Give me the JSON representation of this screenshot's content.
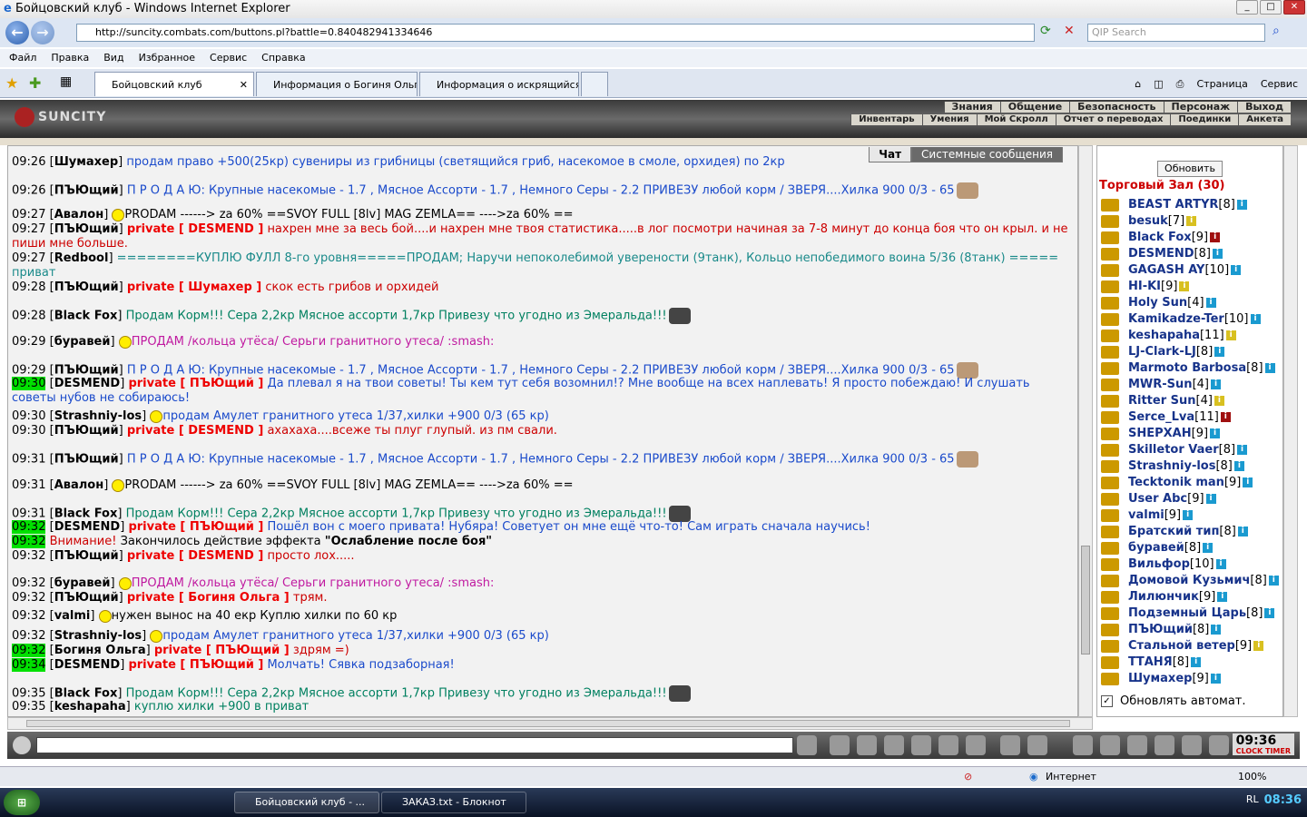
{
  "window": {
    "title": "Бойцовский клуб - Windows Internet Explorer",
    "controls": [
      "minimize-icon",
      "maximize-icon",
      "close-icon"
    ]
  },
  "browser": {
    "url": "http://suncity.combats.com/buttons.pl?battle=0.840482941334646",
    "search_placeholder": "QIP Search",
    "menu": [
      "Файл",
      "Правка",
      "Вид",
      "Избранное",
      "Сервис",
      "Справка"
    ],
    "tabs": [
      "Бойцовский клуб",
      "Информация о Богиня Ольга",
      "Информация о искрящийся"
    ],
    "tools": [
      "Страница",
      "Сервис"
    ],
    "status_zone": "Интернет",
    "zoom": "100%"
  },
  "game": {
    "logo": "SUNCITY",
    "nav_top": [
      "Знания",
      "Общение",
      "Безопасность",
      "Персонаж",
      "Выход"
    ],
    "nav_bottom": [
      "Инвентарь",
      "Умения",
      "Мой Скролл",
      "Отчет о переводах",
      "Поединки",
      "Анкета"
    ],
    "chat_tabs": [
      "Чат",
      "Системные сообщения"
    ],
    "chat": [
      {
        "time": "09:26",
        "nick": "Шумахер",
        "text": "продам право +500(25кр) сувениры из грибницы (светящийся гриб, насекомое в смоле, орхидея) по 2кр",
        "color": "blue"
      },
      {
        "time": "09:26",
        "nick": "ПЪЮщий",
        "text": "П Р О Д А Ю: Крупные насекомые - 1.7 , Мясное Ассорти - 1.7 , Немного Серы - 2.2 ПРИВЕЗУ любой корм / ЗВЕРЯ....Хилка 900 0/3 - 65",
        "color": "blue"
      },
      {
        "time": "09:27",
        "nick": "Авалон",
        "text": "PRODAM ------> za 60% ==SVOY FULL [8lv] MAG ZEMLA== ---->za 60% ==",
        "color": "olive"
      },
      {
        "time": "09:27",
        "nick": "ПЪЮщий",
        "private": "private [ DESMEND ]",
        "text": "нахрен мне за весь бой....и нахрен мне твоя статистика.....в лог посмотри начиная за 7-8 минут до конца боя что он крыл. и не пиши мне больше.",
        "color": "red"
      },
      {
        "time": "09:27",
        "nick": "Redbool",
        "text": "========КУПЛЮ ФУЛЛ 8-го уровня=====ПРОДАМ; Наручи непоколебимой уверености (9танк), Кольцо непобедимого воина 5/36 (8танк) ===== приват",
        "color": "teal"
      },
      {
        "time": "09:28",
        "nick": "ПЪЮщий",
        "private": "private [ Шумахер ]",
        "text": "скок есть грибов и орхидей",
        "color": "red"
      },
      {
        "time": "09:28",
        "nick": "Black Fox",
        "text": "Продам Корм!!! Сера 2,2кр Мясное ассорти 1,7кр Привезу что угодно из Эмеральда!!!",
        "color": "green"
      },
      {
        "time": "09:29",
        "nick": "буравей",
        "text": "ПРОДАМ /кольца утёса/ Серьги гранитного утеса/ :smash:",
        "color": "magenta"
      },
      {
        "time": "09:29",
        "nick": "ПЪЮщий",
        "text": "П Р О Д А Ю: Крупные насекомые - 1.7 , Мясное Ассорти - 1.7 , Немного Серы - 2.2 ПРИВЕЗУ любой корм / ЗВЕРЯ....Хилка 900 0/3 - 65",
        "color": "blue"
      },
      {
        "time": "09:30",
        "nick": "DESMEND",
        "private": "private [ ПЪЮщий ]",
        "text": "Да плевал я на твои советы! Ты кем тут себя возомнил!? Мне вообще на всех наплевать! Я просто побеждаю! И слушать советы нубов не собираюсь!",
        "color": "blue",
        "hl": true
      },
      {
        "time": "09:30",
        "nick": "Strashniy-los",
        "text": "продам Амулет гранитного утеса 1/37,хилки +900 0/3 (65 кр)",
        "color": "blue"
      },
      {
        "time": "09:30",
        "nick": "ПЪЮщий",
        "private": "private [ DESMEND ]",
        "text": "ахахаха....всеже ты плуг глупый. из пм свали.",
        "color": "red"
      },
      {
        "time": "09:31",
        "nick": "ПЪЮщий",
        "text": "П Р О Д А Ю: Крупные насекомые - 1.7 , Мясное Ассорти - 1.7 , Немного Серы - 2.2 ПРИВЕЗУ любой корм / ЗВЕРЯ....Хилка 900 0/3 - 65",
        "color": "blue"
      },
      {
        "time": "09:31",
        "nick": "Авалон",
        "text": "PRODAM ------> za 60% ==SVOY FULL [8lv] MAG ZEMLA== ---->za 60% ==",
        "color": "olive"
      },
      {
        "time": "09:31",
        "nick": "Black Fox",
        "text": "Продам Корм!!! Сера 2,2кр Мясное ассорти 1,7кр Привезу что угодно из Эмеральда!!!",
        "color": "green"
      },
      {
        "time": "09:32",
        "nick": "DESMEND",
        "private": "private [ ПЪЮщий ]",
        "text": "Пошёл вон с моего привата! Нубяра! Советует он мне ещё что-то! Сам играть сначала научись!",
        "color": "blue",
        "hl": true
      },
      {
        "time": "09:32",
        "warning": "Внимание!",
        "text": "Закончилось действие эффекта",
        "effect": "\"Ослабление после боя\"",
        "hl": true
      },
      {
        "time": "09:32",
        "nick": "ПЪЮщий",
        "private": "private [ DESMEND ]",
        "text": "просто лох.....",
        "color": "red"
      },
      {
        "time": "09:32",
        "nick": "буравей",
        "text": "ПРОДАМ /кольца утёса/ Серьги гранитного утеса/ :smash:",
        "color": "magenta"
      },
      {
        "time": "09:32",
        "nick": "ПЪЮщий",
        "private": "private [ Богиня Ольга ]",
        "text": "трям.",
        "color": "red"
      },
      {
        "time": "09:32",
        "nick": "valmi",
        "text": "нужен вынос на 40 екр Куплю хилки по 60 кр",
        "color": "plain"
      },
      {
        "time": "09:32",
        "nick": "Strashniy-los",
        "text": "продам Амулет гранитного утеса 1/37,хилки +900 0/3 (65 кр)",
        "color": "blue"
      },
      {
        "time": "09:32",
        "nick": "Богиня Ольга",
        "private": "private [ ПЪЮщий ]",
        "text": "здрям =)",
        "color": "red",
        "hl": true
      },
      {
        "time": "09:34",
        "nick": "DESMEND",
        "private": "private [ ПЪЮщий ]",
        "text": "Молчать! Сявка подзаборная!",
        "color": "blue",
        "hl": true
      },
      {
        "time": "09:35",
        "nick": "Black Fox",
        "text": "Продам Корм!!! Сера 2,2кр Мясное ассорти 1,7кр Привезу что угодно из Эмеральда!!!",
        "color": "green"
      },
      {
        "time": "09:35",
        "nick": "keshapaha",
        "text": "куплю хилки +900 в приват",
        "color": "green"
      }
    ],
    "room": {
      "refresh_label": "Обновить",
      "title": "Торговый Зал (30)",
      "users": [
        {
          "name": "BEAST ARTYR",
          "level": "[8]"
        },
        {
          "name": "besuk",
          "level": "[7]"
        },
        {
          "name": "Black Fox",
          "level": "[9]"
        },
        {
          "name": "DESMEND",
          "level": "[8]"
        },
        {
          "name": "GAGASH AY",
          "level": "[10]"
        },
        {
          "name": "HI-KI",
          "level": "[9]"
        },
        {
          "name": "Holy Sun",
          "level": "[4]"
        },
        {
          "name": "Kamikadze-Ter",
          "level": "[10]"
        },
        {
          "name": "keshapaha",
          "level": "[11]"
        },
        {
          "name": "LJ-Clark-LJ",
          "level": "[8]"
        },
        {
          "name": "Marmoto Barbosa",
          "level": "[8]"
        },
        {
          "name": "MWR-Sun",
          "level": "[4]"
        },
        {
          "name": "Ritter Sun",
          "level": "[4]"
        },
        {
          "name": "Serce_Lva",
          "level": "[11]"
        },
        {
          "name": "SHEPXAH",
          "level": "[9]"
        },
        {
          "name": "Skilletor Vaer",
          "level": "[8]"
        },
        {
          "name": "Strashniy-los",
          "level": "[8]"
        },
        {
          "name": "Tecktonik man",
          "level": "[9]"
        },
        {
          "name": "User Abc",
          "level": "[9]"
        },
        {
          "name": "valmi",
          "level": "[9]"
        },
        {
          "name": "Братский тип",
          "level": "[8]"
        },
        {
          "name": "буравей",
          "level": "[8]"
        },
        {
          "name": "Вильфор",
          "level": "[10]"
        },
        {
          "name": "Домовой Кузьмич",
          "level": "[8]"
        },
        {
          "name": "Лилюнчик",
          "level": "[9]"
        },
        {
          "name": "Подземный Царь",
          "level": "[8]"
        },
        {
          "name": "ПЪЮщий",
          "level": "[8]"
        },
        {
          "name": "Стальной ветер",
          "level": "[9]"
        },
        {
          "name": "ТТАНЯ",
          "level": "[8]"
        },
        {
          "name": "Шумахер",
          "level": "[9]"
        }
      ],
      "auto_refresh_label": "Обновлять автомат.",
      "auto_refresh_checked": "✓"
    },
    "clock": {
      "time": "09:36",
      "labels": "CLOCK TIMER"
    }
  },
  "taskbar": {
    "start": "⊞",
    "items": [
      "Бойцовский клуб - ...",
      "ЗАКАЗ.txt - Блокнот"
    ],
    "lang": "RL",
    "time": "08:36"
  }
}
